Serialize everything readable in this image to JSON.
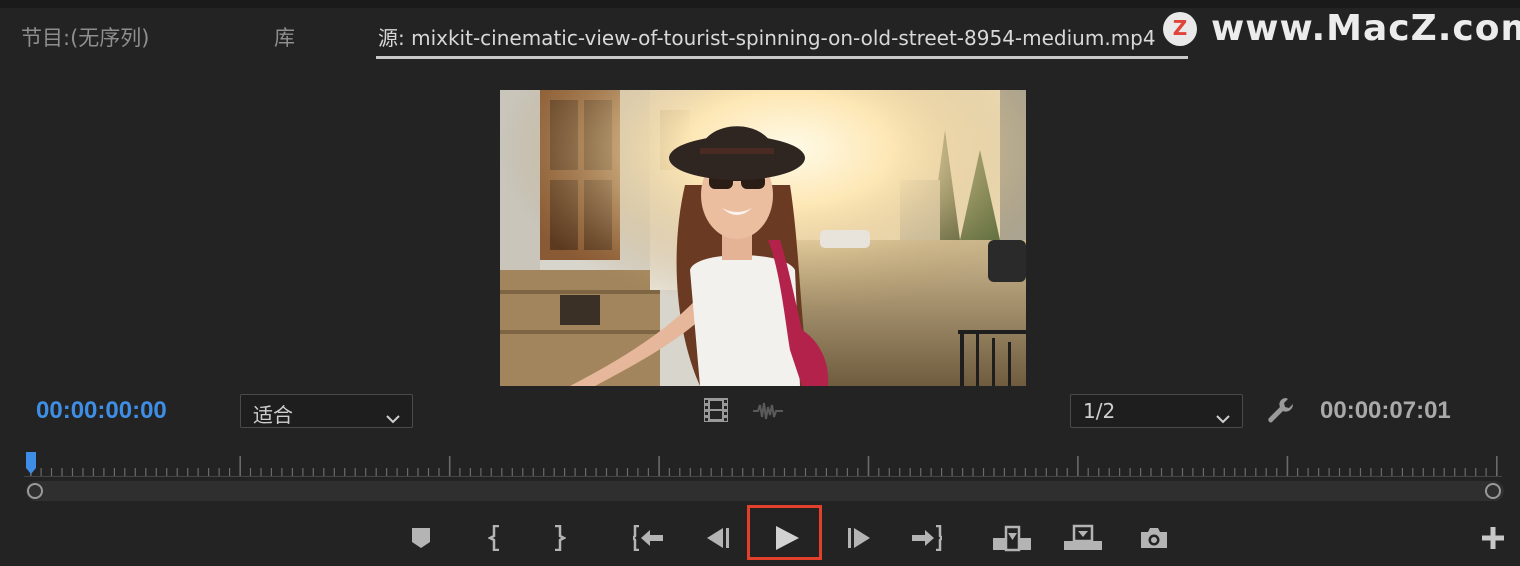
{
  "panel": {
    "tab_program": "节目:(无序列)",
    "tab_library": "库",
    "tab_source": "源: mixkit-cinematic-view-of-tourist-spinning-on-old-street-8954-medium.mp4"
  },
  "watermark": {
    "logo_letter": "Z",
    "text": "www.MacZ.com"
  },
  "controls": {
    "current_timecode": "00:00:00:00",
    "zoom_value": "适合",
    "resolution_value": "1/2",
    "duration_timecode": "00:00:07:01",
    "playhead_position": 0
  },
  "icons": {
    "film": "film-icon",
    "audio": "audio-waveform-icon",
    "wrench": "wrench-icon",
    "marker": "marker-icon",
    "mark_in": "mark-in-icon",
    "mark_out": "mark-out-icon",
    "go_to_in": "go-to-in-icon",
    "step_back": "step-back-icon",
    "play": "play-icon",
    "step_forward": "step-forward-icon",
    "go_to_out": "go-to-out-icon",
    "insert": "insert-icon",
    "overwrite": "overwrite-icon",
    "export_frame": "camera-icon",
    "add": "plus-icon"
  },
  "colors": {
    "background": "#232323",
    "timecode_current": "#3f8ee6",
    "highlight": "#e3402b"
  }
}
